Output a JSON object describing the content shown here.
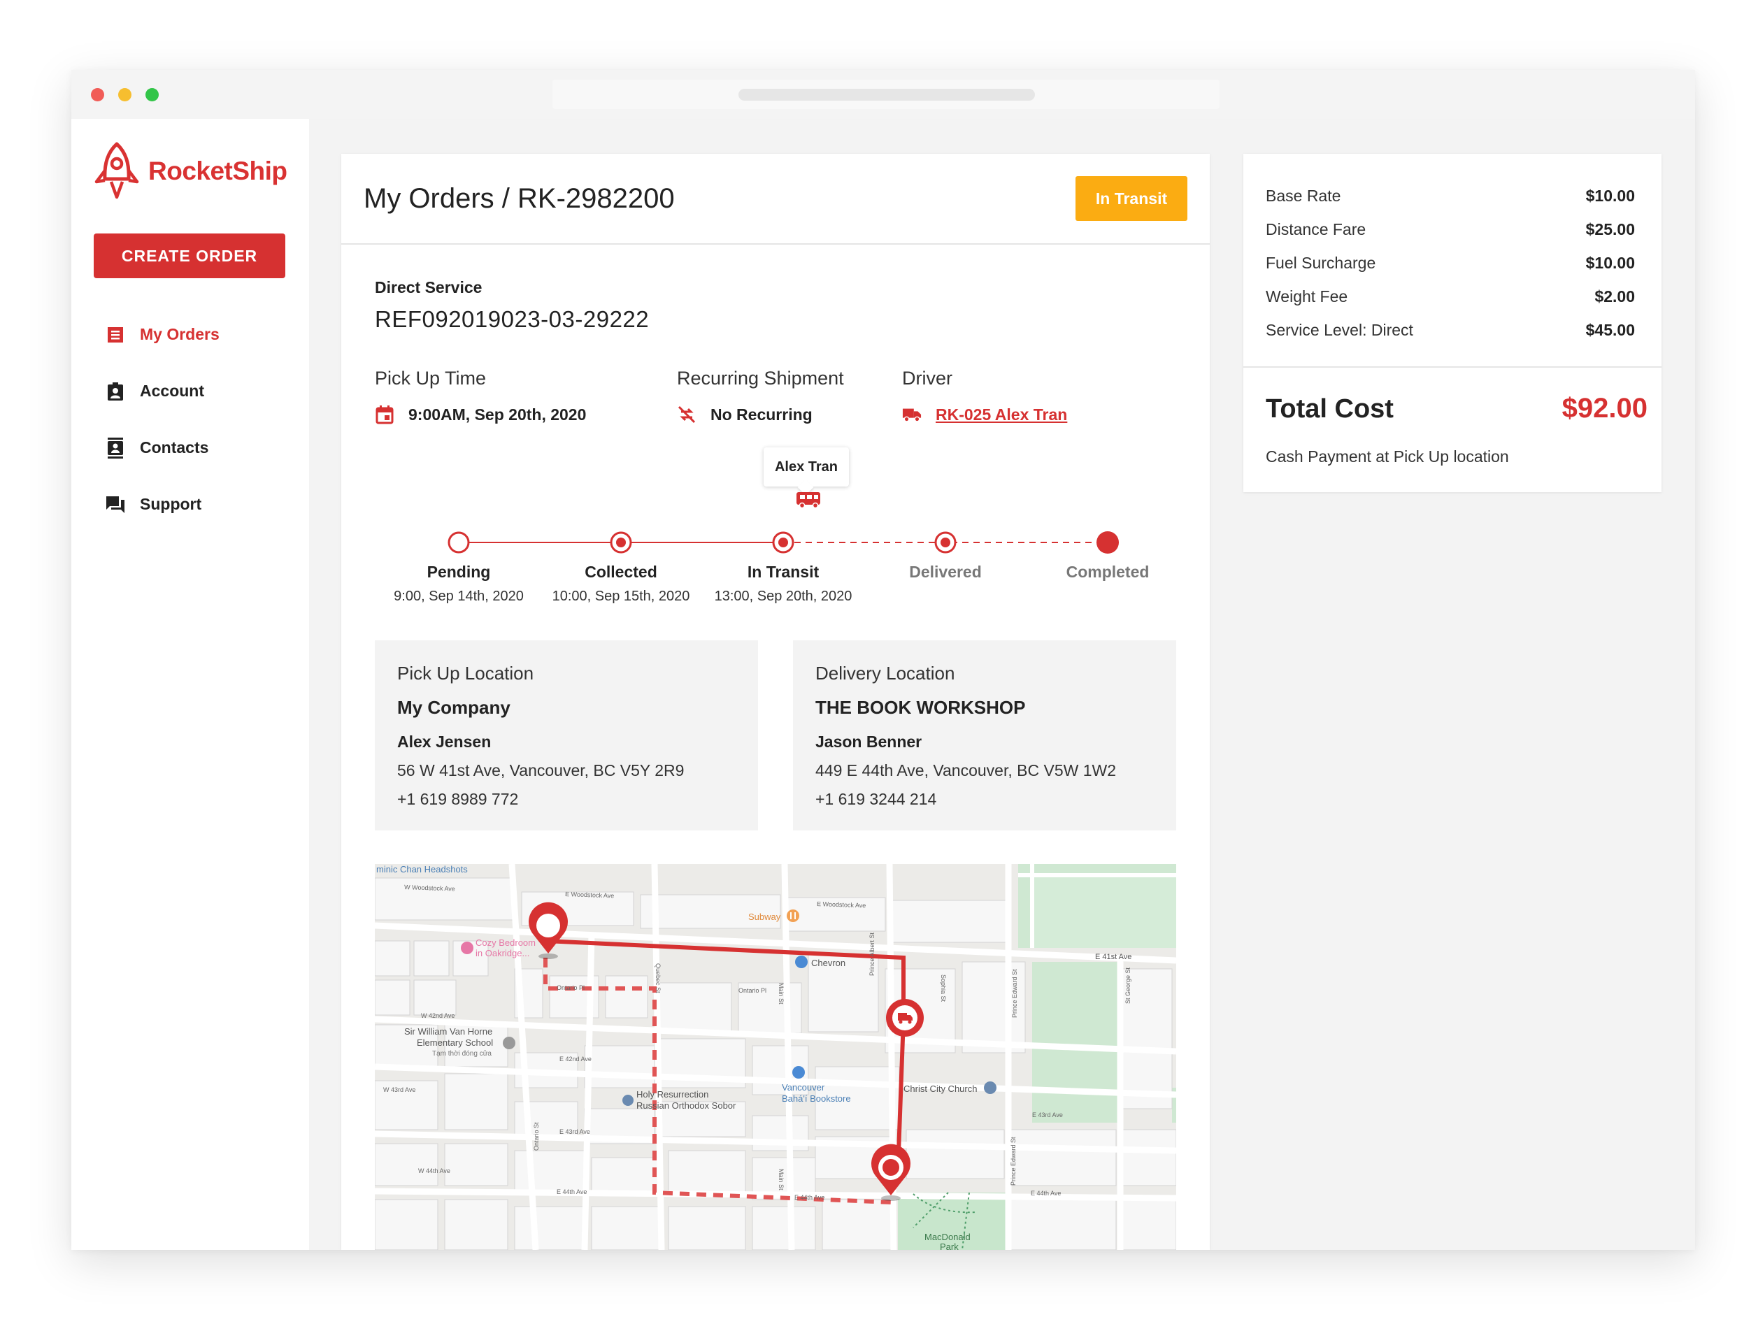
{
  "app": {
    "name": "RocketShip",
    "brand_color": "#d63131"
  },
  "sidebar": {
    "create_order_label": "CREATE ORDER",
    "items": [
      {
        "label": "My Orders",
        "icon": "orders-list-icon",
        "active": true
      },
      {
        "label": "Account",
        "icon": "account-badge-icon",
        "active": false
      },
      {
        "label": "Contacts",
        "icon": "contacts-book-icon",
        "active": false
      },
      {
        "label": "Support",
        "icon": "chat-bubbles-icon",
        "active": false
      }
    ]
  },
  "order": {
    "title": "My Orders / RK-2982200",
    "status": "In Transit",
    "status_color": "#fbac12",
    "service": "Direct Service",
    "reference": "REF092019023-03-29222",
    "pickup_time_label": "Pick Up Time",
    "pickup_time": "9:00AM, Sep 20th, 2020",
    "recurring_label": "Recurring Shipment",
    "recurring_value": "No Recurring",
    "driver_label": "Driver",
    "driver_value": "RK-025 Alex Tran"
  },
  "timeline": {
    "driver_tooltip": "Alex Tran",
    "steps": [
      {
        "label": "Pending",
        "time": "9:00, Sep 14th, 2020",
        "done": true
      },
      {
        "label": "Collected",
        "time": "10:00, Sep 15th, 2020",
        "done": true
      },
      {
        "label": "In Transit",
        "time": "13:00, Sep 20th, 2020",
        "done": true
      },
      {
        "label": "Delivered",
        "time": "",
        "done": false
      },
      {
        "label": "Completed",
        "time": "",
        "done": false
      }
    ]
  },
  "pickup": {
    "title": "Pick Up Location",
    "company": "My Company",
    "contact": "Alex Jensen",
    "address": "56 W 41st Ave, Vancouver, BC V5Y 2R9",
    "phone": "+1 619 8989 772"
  },
  "delivery": {
    "title": "Delivery Location",
    "company": "THE BOOK WORKSHOP",
    "contact": "Jason Benner",
    "address": "449 E 44th Ave, Vancouver, BC V5W 1W2",
    "phone": "+1 619 3244 214"
  },
  "map": {
    "labels": {
      "headshots": "minic Chan Headshots",
      "woodstock_w": "W Woodstock Ave",
      "woodstock_e1": "E Woodstock Ave",
      "woodstock_e2": "E Woodstock Ave",
      "subway": "Subway",
      "cozy_1": "Cozy Bedroom",
      "cozy_2": "in Oakridge...",
      "chevron": "Chevron",
      "e41": "E 41st Ave",
      "ontario_pl": "Ontario Pl",
      "ontario_pl2": "Ontario Pl",
      "w42": "W 42nd Ave",
      "school_1": "Sir William Van Horne",
      "school_2": "Elementary School",
      "school_3": "Tạm thời đóng cửa",
      "e42": "E 42nd Ave",
      "w43": "W 43rd Ave",
      "holy_1": "Holy Resurrection",
      "holy_2": "Russian Orthodox Sobor",
      "bahai_1": "Vancouver",
      "bahai_2": "Bahá'í Bookstore",
      "christ": "Christ City Church",
      "e43a": "E 43rd Ave",
      "e43b": "E 43rd Ave",
      "w44": "W 44th Ave",
      "e44a": "E 44th Ave",
      "e44b": "E 44th Ave",
      "e44c": "E 44th Ave",
      "quebec": "Quebec St",
      "main": "Main St",
      "main2": "Main St",
      "ontario_st": "Ontario St",
      "sophia": "Sophia St",
      "prince_edward": "Prince Edward St",
      "prince_edward2": "Prince Edward St",
      "st_george": "St George St",
      "prince_albert": "Prince Albert St",
      "macdonald_1": "MacDonald",
      "macdonald_2": "Park"
    }
  },
  "cost": {
    "items": [
      {
        "label": "Base Rate",
        "value": "$10.00"
      },
      {
        "label": "Distance Fare",
        "value": "$25.00"
      },
      {
        "label": "Fuel Surcharge",
        "value": "$10.00"
      },
      {
        "label": "Weight Fee",
        "value": "$2.00"
      },
      {
        "label": "Service Level: Direct",
        "value": "$45.00"
      }
    ],
    "total_label": "Total Cost",
    "total_value": "$92.00",
    "payment_note": "Cash Payment at Pick Up location"
  }
}
